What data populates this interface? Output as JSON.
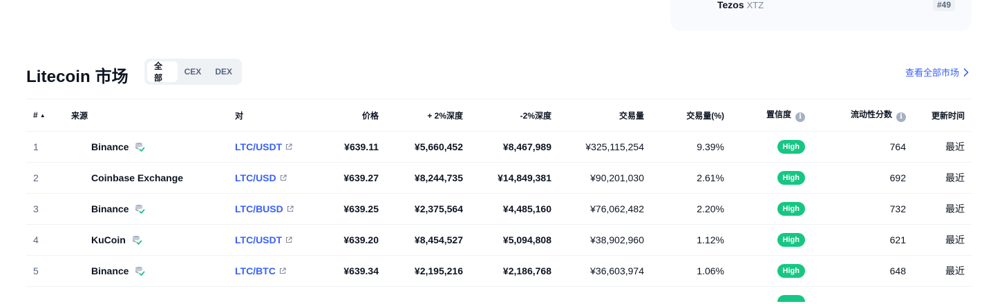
{
  "top_card": {
    "coin_name": "Tezos",
    "coin_symbol": "XTZ",
    "rank": "#49"
  },
  "header": {
    "title": "Litecoin 市场",
    "tabs": [
      {
        "label": "全部",
        "active": true
      },
      {
        "label": "CEX",
        "active": false
      },
      {
        "label": "DEX",
        "active": false
      }
    ],
    "view_all": "查看全部市场"
  },
  "table": {
    "columns": {
      "rank": "#",
      "source": "来源",
      "pair": "对",
      "price": "价格",
      "plus_depth": "+ 2%深度",
      "minus_depth": "-2%深度",
      "volume": "交易量",
      "volume_pct": "交易量(%)",
      "confidence": "置信度",
      "liquidity": "流动性分数",
      "updated": "更新时间"
    },
    "rows": [
      {
        "rank": "1",
        "source": "Binance",
        "verified": true,
        "pair": "LTC/USDT",
        "price": "¥639.11",
        "plus_depth": "¥5,660,452",
        "minus_depth": "¥8,467,989",
        "volume": "¥325,115,254",
        "volume_pct": "9.39%",
        "confidence": "High",
        "liquidity": "764",
        "updated": "最近"
      },
      {
        "rank": "2",
        "source": "Coinbase Exchange",
        "verified": false,
        "pair": "LTC/USD",
        "price": "¥639.27",
        "plus_depth": "¥8,244,735",
        "minus_depth": "¥14,849,381",
        "volume": "¥90,201,030",
        "volume_pct": "2.61%",
        "confidence": "High",
        "liquidity": "692",
        "updated": "最近"
      },
      {
        "rank": "3",
        "source": "Binance",
        "verified": true,
        "pair": "LTC/BUSD",
        "price": "¥639.25",
        "plus_depth": "¥2,375,564",
        "minus_depth": "¥4,485,160",
        "volume": "¥76,062,482",
        "volume_pct": "2.20%",
        "confidence": "High",
        "liquidity": "732",
        "updated": "最近"
      },
      {
        "rank": "4",
        "source": "KuCoin",
        "verified": true,
        "pair": "LTC/USDT",
        "price": "¥639.20",
        "plus_depth": "¥8,454,527",
        "minus_depth": "¥5,094,808",
        "volume": "¥38,902,960",
        "volume_pct": "1.12%",
        "confidence": "High",
        "liquidity": "621",
        "updated": "最近"
      },
      {
        "rank": "5",
        "source": "Binance",
        "verified": true,
        "pair": "LTC/BTC",
        "price": "¥639.34",
        "plus_depth": "¥2,195,216",
        "minus_depth": "¥2,186,768",
        "volume": "¥36,603,974",
        "volume_pct": "1.06%",
        "confidence": "High",
        "liquidity": "648",
        "updated": "最近"
      }
    ]
  },
  "colors": {
    "accent": "#3861fb",
    "high_badge": "#16c784",
    "text_primary": "#0d1421",
    "text_secondary": "#58667e",
    "tab_bg": "#eff2f5"
  },
  "icons": {
    "verified": "verified-stack-icon",
    "external": "external-link-icon",
    "info": "info-icon",
    "sort": "sort-ascending-icon",
    "chevron": "chevron-right-icon"
  }
}
